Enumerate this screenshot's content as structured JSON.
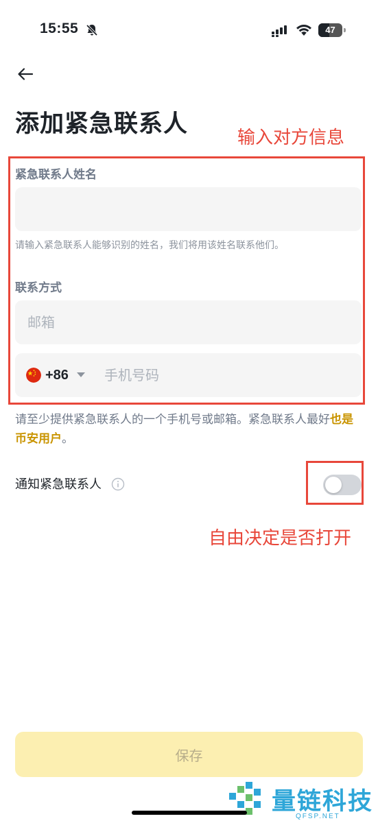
{
  "status_bar": {
    "time": "15:55",
    "battery_level": "47",
    "battery_fraction": 0.47,
    "icons": [
      "bell-off-icon",
      "signal-icon",
      "wifi-icon",
      "battery-icon"
    ]
  },
  "header": {
    "back_icon": "arrow-left-icon",
    "title": "添加紧急联系人"
  },
  "form": {
    "name": {
      "label": "紧急联系人姓名",
      "value": "",
      "placeholder": "",
      "helper": "请输入紧急联系人能够识别的姓名，我们将用该姓名联系他们。"
    },
    "contact": {
      "label": "联系方式",
      "email_placeholder": "邮箱",
      "email_value": "",
      "country_flag": "cn-flag-icon",
      "country_code": "+86",
      "phone_placeholder": "手机号码",
      "phone_value": ""
    },
    "note": {
      "text": "请至少提供紧急联系人的一个手机号或邮箱。紧急联系人最好",
      "link": "也是币安用户",
      "suffix": "。"
    },
    "notify": {
      "label": "通知紧急联系人",
      "info_icon": "info-icon",
      "enabled": false
    }
  },
  "actions": {
    "save_label": "保存"
  },
  "annotations": {
    "input_hint": "输入对方信息",
    "toggle_hint": "自由决定是否打开"
  },
  "colors": {
    "accent_yellow": "#fcefb1",
    "link_gold": "#c99400",
    "annotation_red": "#e8473a",
    "input_bg": "#f5f5f5"
  },
  "watermark": {
    "name": "量链科技",
    "domain": "QFSP.NET"
  }
}
